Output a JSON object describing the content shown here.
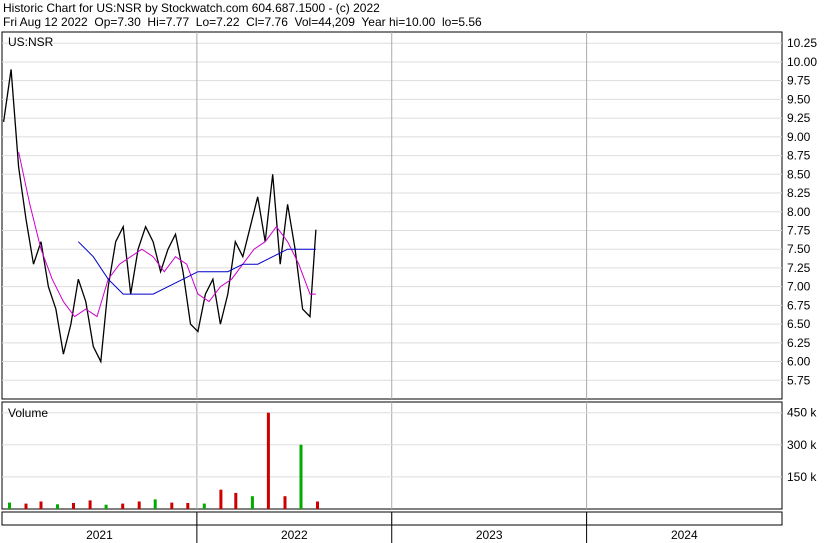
{
  "header": {
    "line1": "Historic Chart for US:NSR by Stockwatch.com 604.687.1500 - (c) 2022",
    "line2": "Fri Aug 12 2022  Op=7.30  Hi=7.77  Lo=7.22  Cl=7.76  Vol=44,209  Year hi=10.00  lo=5.56"
  },
  "chart_data": [
    {
      "type": "line",
      "title": "US:NSR",
      "price_ticks": [
        "10.25",
        "10.00",
        "9.75",
        "9.50",
        "9.25",
        "9.00",
        "8.75",
        "8.50",
        "8.25",
        "8.00",
        "7.75",
        "7.50",
        "7.25",
        "7.00",
        "6.75",
        "6.50",
        "6.25",
        "6.00",
        "5.75"
      ],
      "ylim": [
        5.5,
        10.4
      ],
      "x_labels": [
        "2021",
        "2022",
        "2023",
        "2024"
      ],
      "grid": true,
      "colors": {
        "price": "#000000",
        "ma_short": "#cc00cc",
        "ma_long": "#0000cc"
      },
      "series": [
        {
          "x": [
            "2021-01-04",
            "2021-01-18",
            "2021-02-01",
            "2021-02-15",
            "2021-03-01",
            "2021-03-15",
            "2021-03-29",
            "2021-04-12",
            "2021-04-26",
            "2021-05-10",
            "2021-05-24",
            "2021-06-07",
            "2021-06-21",
            "2021-07-05",
            "2021-07-19",
            "2021-08-02",
            "2021-08-16",
            "2021-08-30",
            "2021-09-13",
            "2021-09-27",
            "2021-10-11",
            "2021-10-25",
            "2021-11-08",
            "2021-11-22",
            "2021-12-06",
            "2021-12-20",
            "2022-01-03",
            "2022-01-17",
            "2022-01-31",
            "2022-02-14",
            "2022-02-28",
            "2022-03-14",
            "2022-03-28",
            "2022-04-11",
            "2022-04-25",
            "2022-05-09",
            "2022-05-23",
            "2022-06-06",
            "2022-06-20",
            "2022-07-04",
            "2022-07-18",
            "2022-08-01",
            "2022-08-12"
          ],
          "values": [
            9.2,
            9.9,
            8.6,
            7.9,
            7.3,
            7.6,
            7.0,
            6.7,
            6.1,
            6.5,
            7.1,
            6.8,
            6.2,
            6.0,
            7.0,
            7.6,
            7.8,
            6.9,
            7.5,
            7.8,
            7.6,
            7.2,
            7.5,
            7.7,
            7.2,
            6.5,
            6.4,
            6.9,
            7.1,
            6.5,
            6.9,
            7.6,
            7.4,
            7.8,
            8.2,
            7.6,
            8.5,
            7.3,
            8.1,
            7.5,
            6.7,
            6.6,
            7.76
          ]
        },
        {
          "x": [
            "2021-02-01",
            "2021-02-22",
            "2021-03-15",
            "2021-04-05",
            "2021-04-26",
            "2021-05-17",
            "2021-06-07",
            "2021-06-28",
            "2021-07-19",
            "2021-08-09",
            "2021-08-30",
            "2021-09-20",
            "2021-10-11",
            "2021-11-01",
            "2021-11-22",
            "2021-12-13",
            "2022-01-03",
            "2022-01-24",
            "2022-02-14",
            "2022-03-07",
            "2022-03-28",
            "2022-04-18",
            "2022-05-09",
            "2022-05-30",
            "2022-06-20",
            "2022-07-11",
            "2022-08-01",
            "2022-08-12"
          ],
          "values": [
            8.8,
            8.1,
            7.5,
            7.1,
            6.8,
            6.6,
            6.7,
            6.6,
            7.1,
            7.3,
            7.4,
            7.5,
            7.4,
            7.2,
            7.4,
            7.3,
            6.9,
            6.8,
            7.0,
            7.1,
            7.3,
            7.5,
            7.6,
            7.8,
            7.6,
            7.3,
            6.9,
            6.9
          ]
        },
        {
          "x": [
            "2021-05-24",
            "2021-06-21",
            "2021-07-19",
            "2021-08-16",
            "2021-09-13",
            "2021-10-11",
            "2021-11-08",
            "2021-12-06",
            "2022-01-03",
            "2022-01-31",
            "2022-02-28",
            "2022-03-28",
            "2022-04-25",
            "2022-05-23",
            "2022-06-20",
            "2022-07-18",
            "2022-08-12"
          ],
          "values": [
            7.6,
            7.4,
            7.1,
            6.9,
            6.9,
            6.9,
            7.0,
            7.1,
            7.2,
            7.2,
            7.2,
            7.3,
            7.3,
            7.4,
            7.5,
            7.5,
            7.5
          ]
        }
      ]
    },
    {
      "type": "bar",
      "title": "Volume",
      "volume_ticks": [
        "450 k",
        "300 k",
        "150 k"
      ],
      "ylim": [
        0,
        500000
      ],
      "colors": {
        "up": "#00aa00",
        "down": "#cc0000"
      },
      "x": [
        "2021-01",
        "2021-02",
        "2021-03",
        "2021-04",
        "2021-05",
        "2021-06",
        "2021-07",
        "2021-08",
        "2021-09",
        "2021-10",
        "2021-11",
        "2021-12",
        "2022-01",
        "2022-02",
        "2022-03",
        "2022-04",
        "2022-05",
        "2022-06",
        "2022-07",
        "2022-08"
      ],
      "values": [
        30000,
        25000,
        35000,
        22000,
        28000,
        40000,
        20000,
        25000,
        35000,
        45000,
        30000,
        28000,
        25000,
        90000,
        75000,
        60000,
        450000,
        60000,
        300000,
        35000
      ]
    }
  ]
}
